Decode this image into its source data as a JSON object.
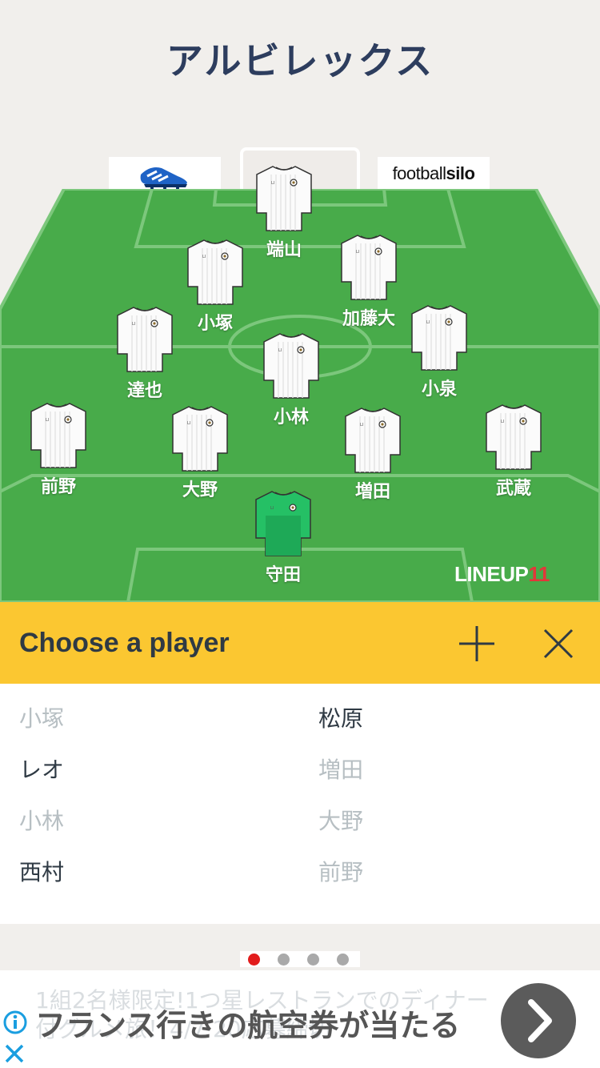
{
  "header": {
    "title": "アルビレックス"
  },
  "sponsors": {
    "right_label_thin": "football",
    "right_label_bold": "silo"
  },
  "pitch": {
    "grass_color": "#48ab4a",
    "line_color": "#7cc77c",
    "players": [
      {
        "name": "端山",
        "position": "forward",
        "kit": "outfield"
      },
      {
        "name": "小塚",
        "position": "attacking-mid-left",
        "kit": "outfield"
      },
      {
        "name": "加藤大",
        "position": "attacking-mid-right",
        "kit": "outfield"
      },
      {
        "name": "達也",
        "position": "left-mid",
        "kit": "outfield"
      },
      {
        "name": "小林",
        "position": "central-mid",
        "kit": "outfield"
      },
      {
        "name": "小泉",
        "position": "right-mid",
        "kit": "outfield"
      },
      {
        "name": "前野",
        "position": "left-back",
        "kit": "outfield"
      },
      {
        "name": "大野",
        "position": "centre-back-left",
        "kit": "outfield"
      },
      {
        "name": "増田",
        "position": "centre-back-right",
        "kit": "outfield"
      },
      {
        "name": "武蔵",
        "position": "right-back",
        "kit": "outfield"
      },
      {
        "name": "守田",
        "position": "goalkeeper",
        "kit": "keeper"
      }
    ]
  },
  "brand": {
    "text": "LINEUP",
    "number": "11"
  },
  "chooser": {
    "title": "Choose a player",
    "add_icon": "plus-icon",
    "close_icon": "close-icon",
    "accent_color": "#fbc731"
  },
  "player_list": [
    {
      "name": "小塚",
      "selected": true
    },
    {
      "name": "松原",
      "selected": false
    },
    {
      "name": "レオ",
      "selected": false
    },
    {
      "name": "増田",
      "selected": true
    },
    {
      "name": "小林",
      "selected": true
    },
    {
      "name": "大野",
      "selected": true
    },
    {
      "name": "西村",
      "selected": false
    },
    {
      "name": "前野",
      "selected": true
    }
  ],
  "pager": {
    "count": 4,
    "active_index": 0
  },
  "ad": {
    "background_text": "1組2名様限定!1つ星レストランでのディナー付グルメ旅！4/7 20応募締切",
    "headline": "フランス行きの航空券が当たる",
    "arrow_icon": "chevron-right-icon",
    "info_icon": "info-icon",
    "close_icon": "close-icon"
  }
}
